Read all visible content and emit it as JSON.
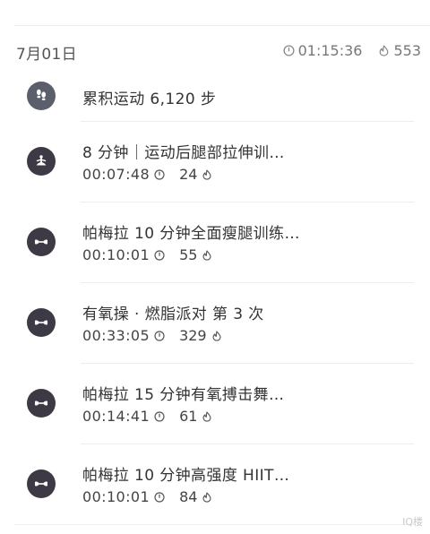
{
  "day": {
    "date": "7月01日",
    "total_duration": "01:15:36",
    "total_calories": "553"
  },
  "colors": {
    "avatar_steps": "#5b5f6b",
    "avatar_workout": "#3e3a45"
  },
  "items": [
    {
      "type": "steps",
      "icon": "footprints-icon",
      "title": "累积运动 6,120 步"
    },
    {
      "type": "workout",
      "icon": "yoga-meditation-icon",
      "title": "8 分钟｜运动后腿部拉伸训…",
      "duration": "00:07:48",
      "calories": "24"
    },
    {
      "type": "workout",
      "icon": "dumbbell-icon",
      "title": "帕梅拉 10 分钟全面瘦腿训练…",
      "duration": "00:10:01",
      "calories": "55"
    },
    {
      "type": "workout",
      "icon": "dumbbell-icon",
      "title": "有氧操 · 燃脂派对  第 3 次",
      "duration": "00:33:05",
      "calories": "329"
    },
    {
      "type": "workout",
      "icon": "dumbbell-icon",
      "title": "帕梅拉 15 分钟有氧搏击舞…",
      "duration": "00:14:41",
      "calories": "61"
    },
    {
      "type": "workout",
      "icon": "dumbbell-icon",
      "title": "帕梅拉 10 分钟高强度 HIIT…",
      "duration": "00:10:01",
      "calories": "84"
    }
  ],
  "watermark": "IQ楼"
}
